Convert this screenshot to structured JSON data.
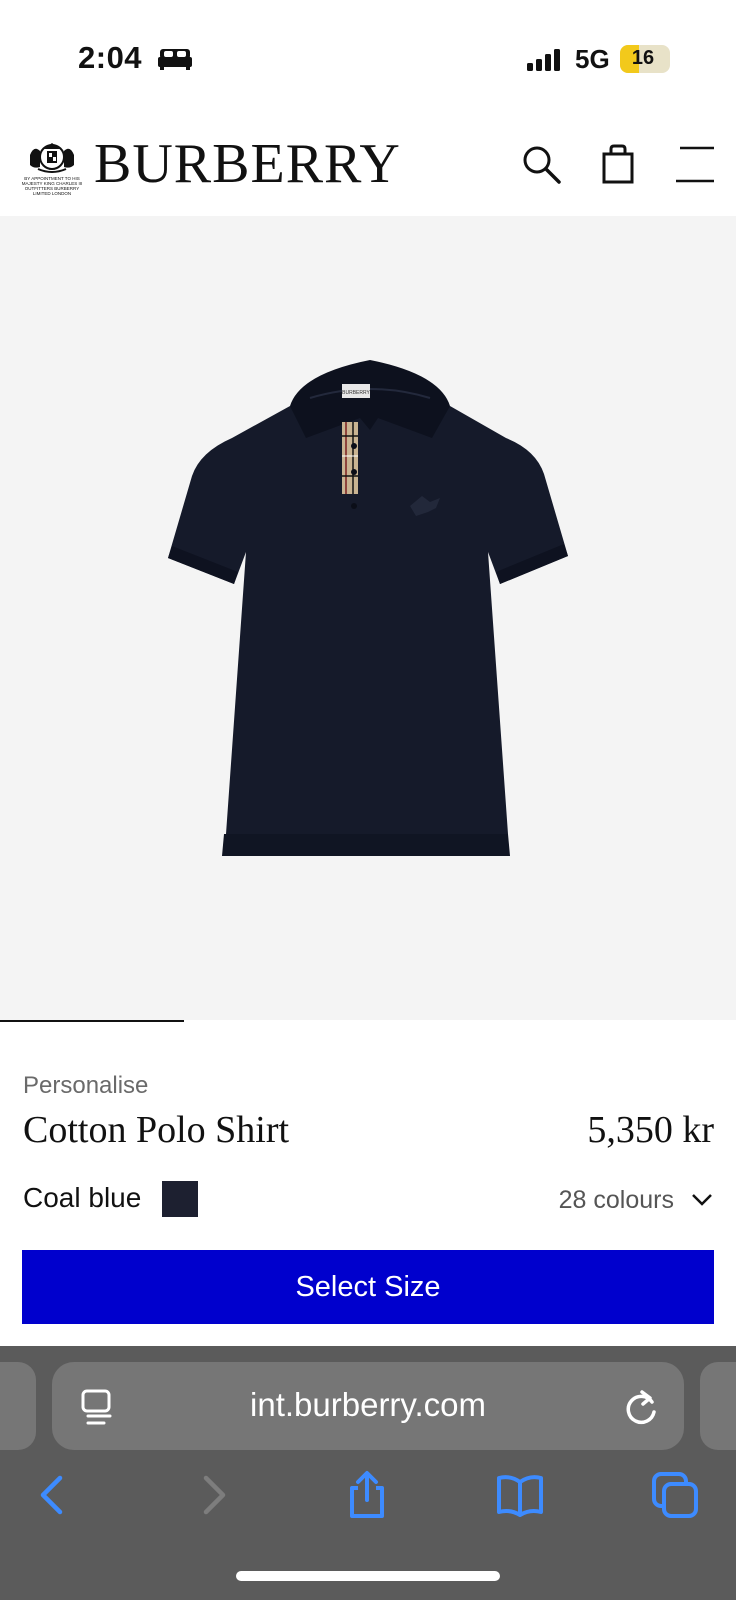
{
  "status_bar": {
    "time": "2:04",
    "network": "5G",
    "battery": "16"
  },
  "header": {
    "brand": "BURBERRY",
    "warrant_text": "BY APPOINTMENT TO HIS MAJESTY KING CHARLES III OUTFITTERS BURBERRY LIMITED LONDON",
    "icons": [
      "search-icon",
      "shopping-bag-icon",
      "menu-icon"
    ]
  },
  "gallery": {
    "image_index": 1,
    "image_count": 4,
    "shirt_color": "#151a2a",
    "shirt_label": "BURBERRY"
  },
  "product": {
    "personalise": "Personalise",
    "name": "Cotton Polo Shirt",
    "price": "5,350 kr",
    "colour_name": "Coal blue",
    "colour_hex": "#1d2030",
    "colours_count": "28 colours",
    "cta": "Select Size",
    "cta_color": "#0000cd"
  },
  "browser": {
    "url": "int.burberry.com",
    "toolbar_icons": [
      "back-icon",
      "forward-icon",
      "share-icon",
      "bookmarks-icon",
      "tabs-icon"
    ],
    "accent": "#3d8bff"
  }
}
